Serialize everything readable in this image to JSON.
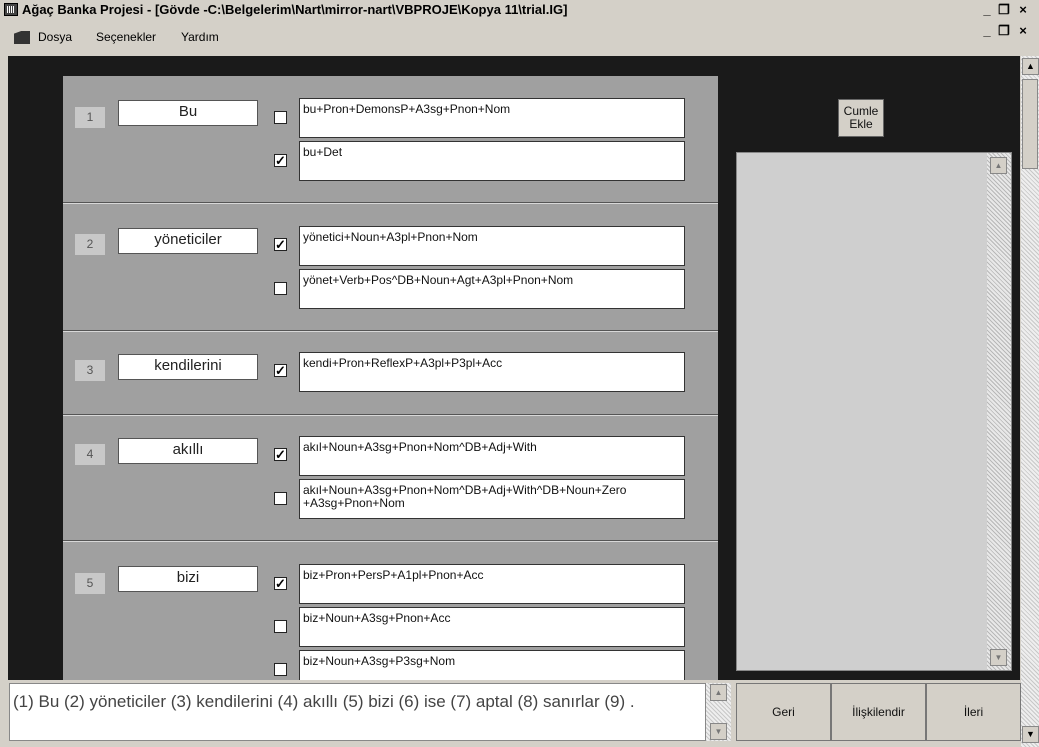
{
  "window": {
    "title": "Ağaç Banka Projesi - [Gövde -C:\\Belgelerim\\Nart\\mirror-nart\\VBPROJE\\Kopya 11\\trial.IG]"
  },
  "menu": {
    "items": [
      "Dosya",
      "Seçenekler",
      "Yardım"
    ]
  },
  "words": [
    {
      "num": "1",
      "word": "Bu",
      "analyses": [
        {
          "text": "bu+Pron+DemonsP+A3sg+Pnon+Nom",
          "checked": false
        },
        {
          "text": "bu+Det",
          "checked": true
        }
      ]
    },
    {
      "num": "2",
      "word": "yöneticiler",
      "analyses": [
        {
          "text": "yönetici+Noun+A3pl+Pnon+Nom",
          "checked": true
        },
        {
          "text": "yönet+Verb+Pos^DB+Noun+Agt+A3pl+Pnon+Nom",
          "checked": false
        }
      ]
    },
    {
      "num": "3",
      "word": "kendilerini",
      "analyses": [
        {
          "text": "kendi+Pron+ReflexP+A3pl+P3pl+Acc",
          "checked": true
        }
      ]
    },
    {
      "num": "4",
      "word": "akıllı",
      "analyses": [
        {
          "text": "akıl+Noun+A3sg+Pnon+Nom^DB+Adj+With",
          "checked": true
        },
        {
          "text": "akıl+Noun+A3sg+Pnon+Nom^DB+Adj+With^DB+Noun+Zero +A3sg+Pnon+Nom",
          "checked": false
        }
      ]
    },
    {
      "num": "5",
      "word": "bizi",
      "analyses": [
        {
          "text": "biz+Pron+PersP+A1pl+Pnon+Acc",
          "checked": true
        },
        {
          "text": "biz+Noun+A3sg+Pnon+Acc",
          "checked": false
        },
        {
          "text": "biz+Noun+A3sg+P3sg+Nom",
          "checked": false
        }
      ]
    }
  ],
  "cumle_button": {
    "line1": "Cumle",
    "line2": "Ekle"
  },
  "sentence": "(1) Bu   (2) yöneticiler   (3) kendilerini   (4) akıllı   (5) bizi   (6) ise   (7) aptal   (8) sanırlar   (9) .",
  "buttons": {
    "geri": "Geri",
    "iliskilendir": "İlişkilendir",
    "ileri": "İleri"
  },
  "colors": {
    "work_bg": "#1a1a1a",
    "panel_bg": "#a0a0a0",
    "chrome": "#d4d0c8"
  }
}
